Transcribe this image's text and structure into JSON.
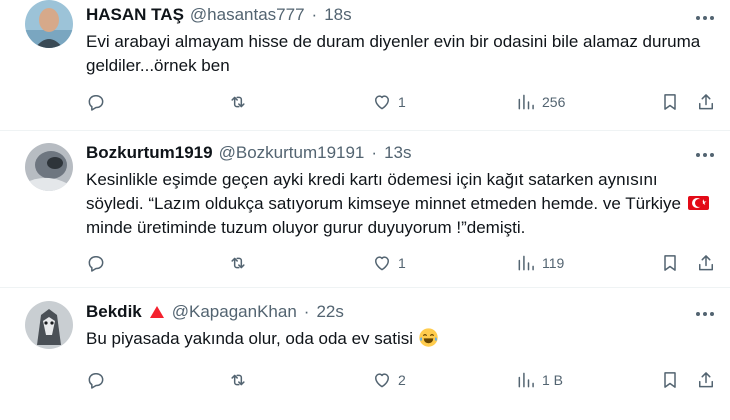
{
  "tweets": [
    {
      "name": "HASAN TAŞ",
      "handle": "@hasantas777",
      "separator": "·",
      "time": "18s",
      "text": "Evi arabayi almayam hisse de duram diyenler evin bir odasini bile alamaz duruma geldiler...örnek ben",
      "likes": "1",
      "views": "256"
    },
    {
      "name": "Bozkurtum1919",
      "handle": "@Bozkurtum19191",
      "separator": "·",
      "time": "13s",
      "text_part1": "Kesinlikle eşimde geçen ayki kredi kartı ödemesi için kağıt satarken aynısını söyledi. “Lazım oldukça satıyorum kimseye minnet etmeden hemde. ve Türkiye",
      "text_part2": "minde üretiminde tuzum oluyor gurur duyuyorum !”demişti.",
      "likes": "1",
      "views": "119"
    },
    {
      "name": "Bekdik",
      "handle": "@KapaganKhan",
      "separator": "·",
      "time": "22s",
      "text": "Bu piyasada yakında olur, oda oda ev satisi",
      "likes": "2",
      "views": "1 B"
    }
  ],
  "icons": {
    "reply": "reply-icon",
    "retweet": "retweet-icon",
    "like": "heart-icon",
    "views": "views-icon",
    "bookmark": "bookmark-icon",
    "share": "share-icon",
    "more": "more-icon",
    "flag": "turkey-flag-icon",
    "emoji": "laughing-tears-emoji-icon",
    "badge": "red-triangle-badge-icon"
  },
  "colors": {
    "text": "#0f1419",
    "secondary": "#536471",
    "divider": "#eff3f4",
    "flag_red": "#e30a17",
    "badge_red": "#f4212e"
  }
}
